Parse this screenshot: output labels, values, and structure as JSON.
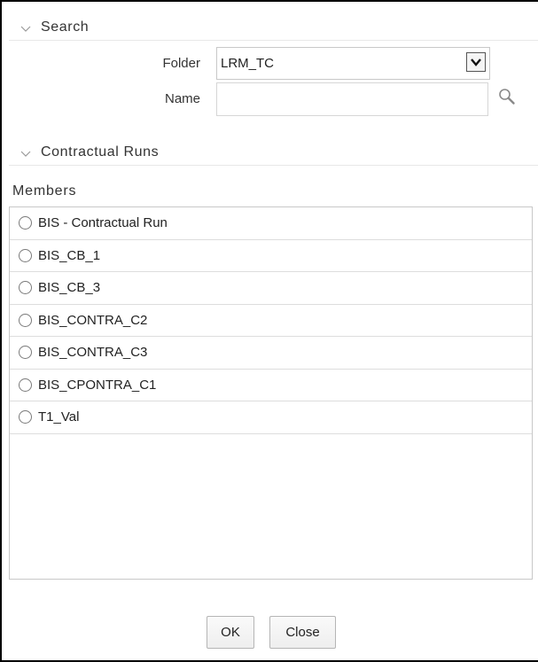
{
  "search_section": {
    "title": "Search",
    "folder_label": "Folder",
    "folder_value": "LRM_TC",
    "name_label": "Name",
    "name_value": "",
    "name_placeholder": ""
  },
  "runs_section": {
    "title": "Contractual Runs"
  },
  "members": {
    "header": "Members",
    "items": [
      {
        "label": "BIS - Contractual Run",
        "selected": false
      },
      {
        "label": "BIS_CB_1",
        "selected": false
      },
      {
        "label": "BIS_CB_3",
        "selected": false
      },
      {
        "label": "BIS_CONTRA_C2",
        "selected": false
      },
      {
        "label": "BIS_CONTRA_C3",
        "selected": false
      },
      {
        "label": "BIS_CPONTRA_C1",
        "selected": false
      },
      {
        "label": "T1_Val",
        "selected": false
      }
    ]
  },
  "buttons": {
    "ok": "OK",
    "close": "Close"
  },
  "icons": {
    "section_chevron": "chevron-down-icon",
    "dropdown": "dropdown-arrow-icon",
    "search": "magnifier-icon"
  }
}
